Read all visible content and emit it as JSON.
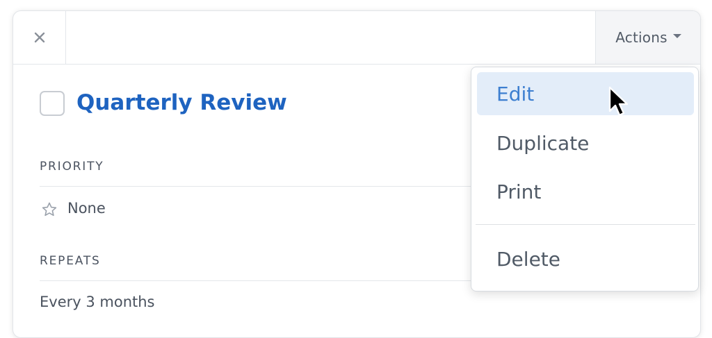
{
  "header": {
    "close_icon": "close-icon",
    "actions_label": "Actions",
    "actions_icon": "caret-down-icon"
  },
  "task": {
    "title": "Quarterly Review",
    "checked": false
  },
  "priority": {
    "label": "PRIORITY",
    "value": "None",
    "icon": "star-outline-icon"
  },
  "repeats": {
    "label": "REPEATS",
    "value": "Every 3 months"
  },
  "menu": {
    "items": [
      {
        "label": "Edit",
        "highlighted": true
      },
      {
        "label": "Duplicate",
        "highlighted": false
      },
      {
        "label": "Print",
        "highlighted": false
      },
      {
        "label": "Delete",
        "highlighted": false
      }
    ]
  },
  "colors": {
    "title": "#1e63c0",
    "menu_highlight_bg": "#e3edf9",
    "menu_highlight_text": "#3d7fd0"
  }
}
